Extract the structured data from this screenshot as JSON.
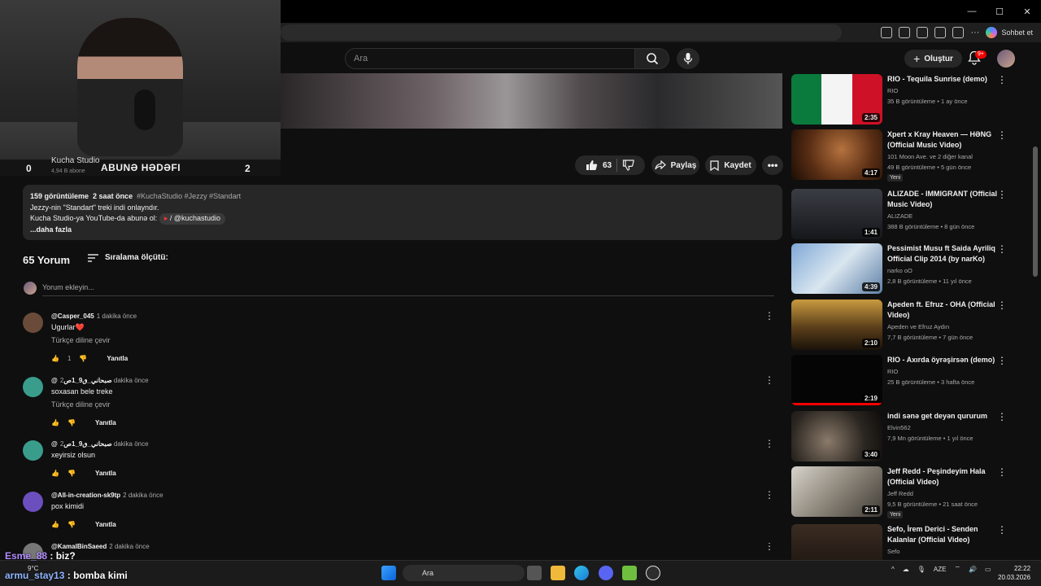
{
  "browser": {
    "window_controls": [
      "—",
      "☐",
      "✕"
    ],
    "chat_button": "Sohbet et"
  },
  "header": {
    "search_placeholder": "Ara",
    "create_label": "Oluştur",
    "notif_badge": "9+"
  },
  "stream_overlay": {
    "sub_goal_start": "0",
    "sub_goal_label": "ABUNƏ HƏDƏFI",
    "sub_goal_target": "2"
  },
  "channel": {
    "name": "Kucha Studio",
    "subscribers": "4,94 B abone"
  },
  "actions": {
    "likes": "63",
    "share": "Paylaş",
    "save": "Kaydet"
  },
  "description": {
    "views": "159 görüntüleme",
    "age": "2 saat önce",
    "tags": "#KuchaStudio #Jezzy #Standart",
    "line1": "Jezzy-nin \"Standart\" treki indi onlayndır.",
    "line2_prefix": "Kucha Studio-ya YouTube-da abunə ol:",
    "handle": "/ @kuchastudio",
    "more": "...daha fazla"
  },
  "comments": {
    "count_label": "65 Yorum",
    "sort_label": "Sıralama ölçütü:",
    "add_placeholder": "Yorum ekleyin...",
    "translate_label": "Türkçe diline çevir",
    "reply_label": "Yanıtla",
    "items": [
      {
        "author": "@Casper_045",
        "time": "1 dakika önce",
        "text": "Ugurlar❤️",
        "likes": "1",
        "avatar_color": "#6a4b3a"
      },
      {
        "author": "@صبحاني_ٯ9_1ص",
        "time": "2 dakika önce",
        "text": "soxasan bele treke",
        "likes": "",
        "avatar_color": "#3a9d8c"
      },
      {
        "author": "@صبحاني_ٯ9_1ص",
        "time": "2 dakika önce",
        "text": "xeyirsiz olsun",
        "likes": "",
        "avatar_color": "#3a9d8c"
      },
      {
        "author": "@All-in-creation-sk9tp",
        "time": "2 dakika önce",
        "text": "pox kimidi",
        "likes": "",
        "avatar_color": "#6b4fbf"
      },
      {
        "author": "@KamalBinSaeed",
        "time": "2 dakika önce",
        "text": "",
        "likes": "",
        "avatar_color": "#777777"
      }
    ]
  },
  "recommendations": [
    {
      "title": "RIO - Tequila Sunrise (demo)",
      "channel": "RIO",
      "meta": "35 B görüntüleme • 1 ay önce",
      "duration": "2:35",
      "badge": "",
      "progress": 0
    },
    {
      "title": "Xpert x Kray Heaven — HƏNG (Official Music Video)",
      "channel": "101 Moon Ave. ve 2 diğer kanal",
      "meta": "49 B görüntüleme • 5 gün önce",
      "duration": "4:17",
      "badge": "Yeni",
      "progress": 0
    },
    {
      "title": "ALIZADE - IMMIGRANT (Official Music Video)",
      "channel": "ALIZADE",
      "meta": "388 B görüntüleme • 8 gün önce",
      "duration": "1:41",
      "badge": "",
      "progress": 0
    },
    {
      "title": "Pessimist Musu ft Saida Ayriliq Official Clip 2014 (by narKo)",
      "channel": "narko oO",
      "meta": "2,8 B görüntüleme • 11 yıl önce",
      "duration": "4:39",
      "badge": "",
      "progress": 0
    },
    {
      "title": "Apeden ft. Efruz - OHA (Official Video)",
      "channel": "Apeden ve Efruz Aydın",
      "meta": "7,7 B görüntüleme • 7 gün önce",
      "duration": "2:10",
      "badge": "",
      "progress": 0
    },
    {
      "title": "RIO - Axırda öyrəşirsən (demo)",
      "channel": "RIO",
      "meta": "25 B görüntüleme • 3 hafta önce",
      "duration": "2:19",
      "badge": "",
      "progress": 1
    },
    {
      "title": "indi sənə get deyən qururum",
      "channel": "Elvin562",
      "meta": "7,9 Mn görüntüleme • 1 yıl önce",
      "duration": "3:40",
      "badge": "",
      "progress": 0
    },
    {
      "title": "Jeff Redd - Peşindeyim Hala (Official Video)",
      "channel": "Jeff Redd",
      "meta": "9,5 B görüntüleme • 21 saat önce",
      "duration": "2:11",
      "badge": "Yeni",
      "progress": 0
    },
    {
      "title": "Sefo, İrem Derici - Senden Kalanlar (Official Video)",
      "channel": "Sefo",
      "meta": "",
      "duration": "",
      "badge": "",
      "progress": 0
    }
  ],
  "chat": [
    {
      "user": "Esme_88",
      "message": ": biz?"
    },
    {
      "user": "armu_stay13",
      "message": ": bomba kimi"
    }
  ],
  "taskbar": {
    "weather": "9°C",
    "search": "Ara",
    "lang": "AZE",
    "time": "22:22",
    "date": "20.03.2026"
  }
}
